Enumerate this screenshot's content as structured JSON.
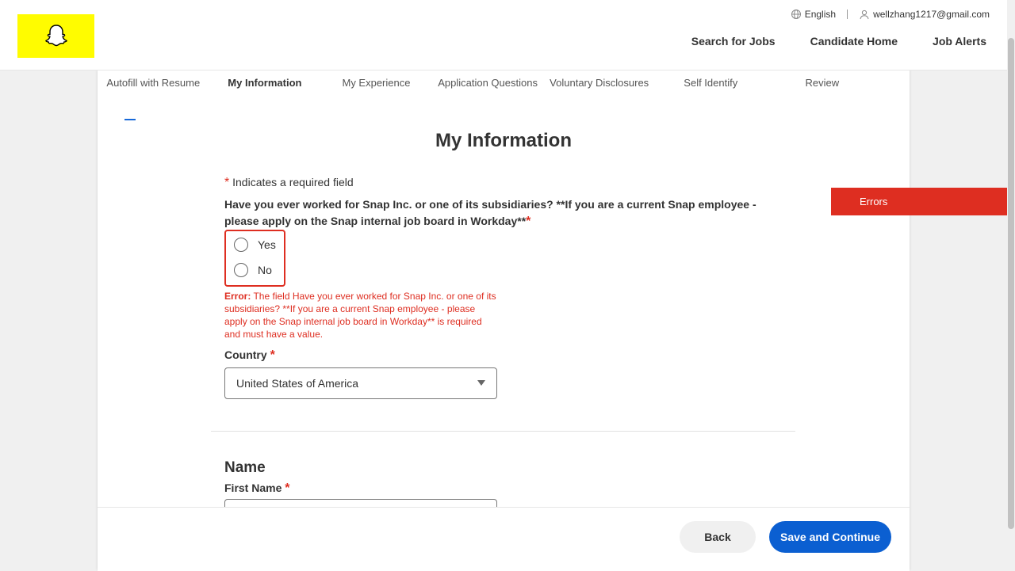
{
  "header": {
    "language": "English",
    "email": "wellzhang1217@gmail.com",
    "nav": [
      "Search for Jobs",
      "Candidate Home",
      "Job Alerts"
    ]
  },
  "steps": [
    "Autofill with Resume",
    "My Information",
    "My Experience",
    "Application Questions",
    "Voluntary Disclosures",
    "Self Identify",
    "Review"
  ],
  "active_step": 1,
  "page": {
    "title": "My Information",
    "required_note": "Indicates a required field",
    "question": "Have you ever worked for Snap Inc. or one of its subsidiaries? **If you are a current Snap employee - please apply on the Snap internal job board in Workday**",
    "options": [
      "Yes",
      "No"
    ],
    "error_prefix": "Error:",
    "error_message": "The field Have you ever worked for Snap Inc. or one of its subsidiaries? **If you are a current Snap employee - please apply on the Snap internal job board in Workday** is required and must have a value.",
    "country_label": "Country",
    "country_value": "United States of America",
    "name_section": "Name",
    "first_name_label": "First Name"
  },
  "errors_tab": "Errors",
  "footer": {
    "back": "Back",
    "save": "Save and Continue"
  },
  "colors": {
    "brand_yellow": "#fffc00",
    "error_red": "#de2e21",
    "primary_blue": "#0b5fd1"
  }
}
